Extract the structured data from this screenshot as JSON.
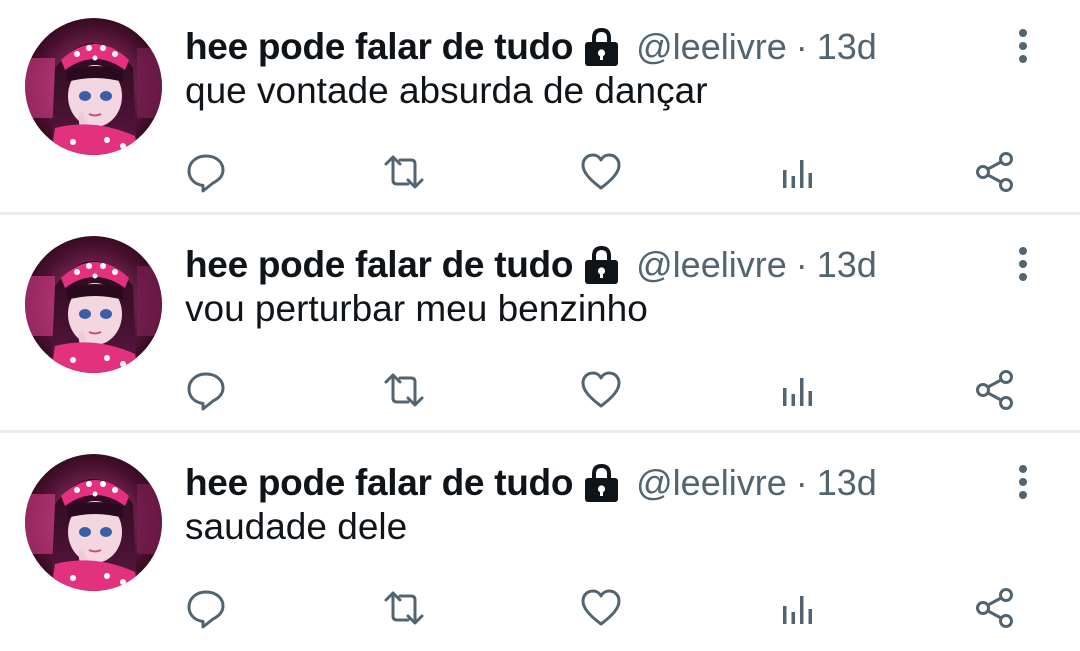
{
  "colors": {
    "name": "#0f1419",
    "secondary": "#536471",
    "icon": "#536471",
    "divider": "#e6ecf0"
  },
  "tweets": [
    {
      "display_name": "hee pode falar de tudo",
      "handle": "@leelivre",
      "separator": "·",
      "time": "13d",
      "text": "que vontade absurda de dançar",
      "icons": [
        "lock-icon",
        "more-icon",
        "reply-icon",
        "retweet-icon",
        "like-icon",
        "analytics-icon",
        "share-icon"
      ]
    },
    {
      "display_name": "hee pode falar de tudo",
      "handle": "@leelivre",
      "separator": "·",
      "time": "13d",
      "text": "vou perturbar meu benzinho",
      "icons": [
        "lock-icon",
        "more-icon",
        "reply-icon",
        "retweet-icon",
        "like-icon",
        "analytics-icon",
        "share-icon"
      ]
    },
    {
      "display_name": "hee pode falar de tudo",
      "handle": "@leelivre",
      "separator": "·",
      "time": "13d",
      "text": "saudade dele",
      "icons": [
        "lock-icon",
        "more-icon",
        "reply-icon",
        "retweet-icon",
        "like-icon",
        "analytics-icon",
        "share-icon"
      ]
    }
  ]
}
